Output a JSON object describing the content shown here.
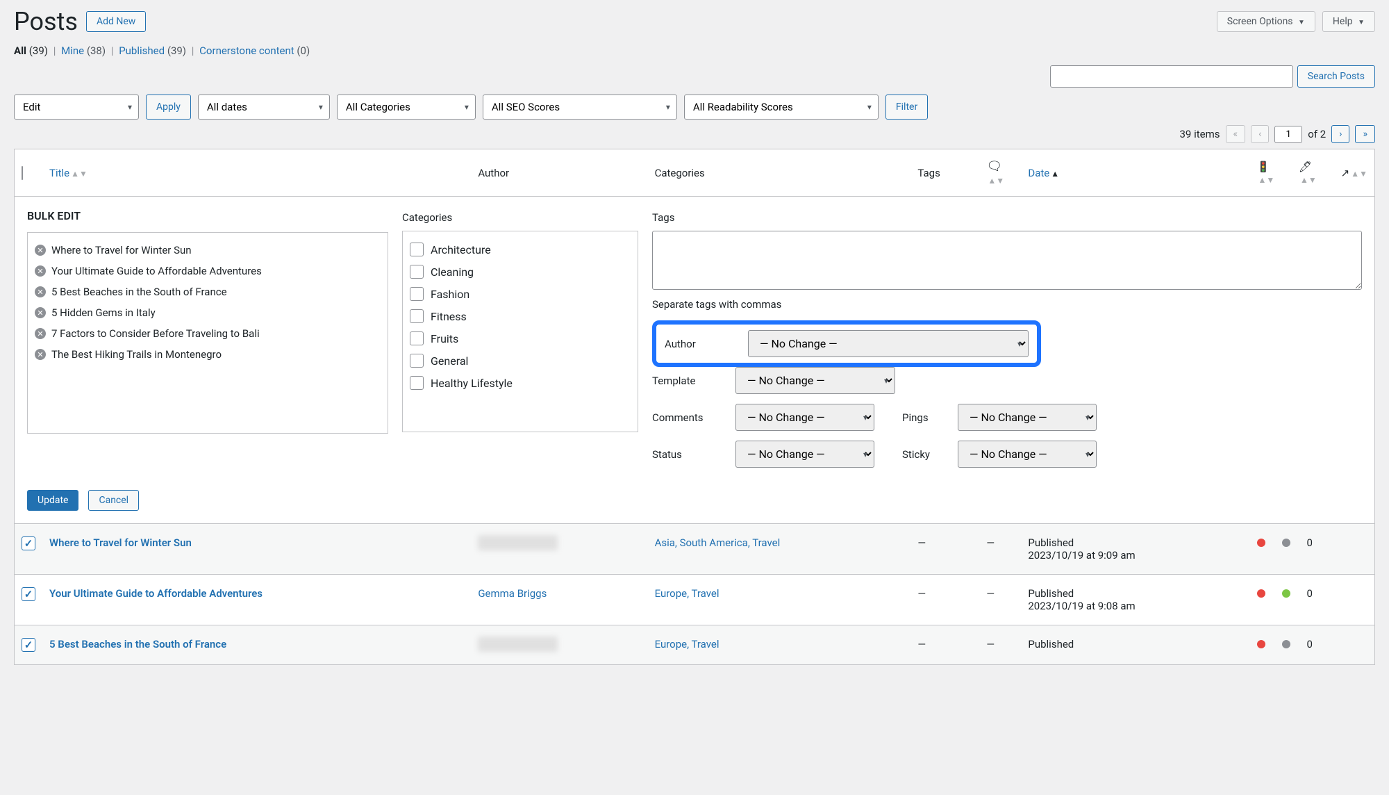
{
  "header": {
    "title": "Posts",
    "add_new": "Add New",
    "screen_options": "Screen Options",
    "help": "Help"
  },
  "filters": {
    "all_label": "All",
    "all_count": "(39)",
    "mine_label": "Mine",
    "mine_count": "(38)",
    "published_label": "Published",
    "published_count": "(39)",
    "cornerstone_label": "Cornerstone content",
    "cornerstone_count": "(0)"
  },
  "search": {
    "button": "Search Posts"
  },
  "bulk": {
    "action": "Edit",
    "apply": "Apply",
    "dates": "All dates",
    "categories": "All Categories",
    "seo": "All SEO Scores",
    "readability": "All Readability Scores",
    "filter": "Filter"
  },
  "pagination": {
    "items": "39 items",
    "current": "1",
    "total": "of 2"
  },
  "columns": {
    "title": "Title",
    "author": "Author",
    "categories": "Categories",
    "tags": "Tags",
    "date": "Date"
  },
  "bulkedit": {
    "heading": "BULK EDIT",
    "cat_heading": "Categories",
    "tags_heading": "Tags",
    "tags_hint": "Separate tags with commas",
    "posts": [
      "Where to Travel for Winter Sun",
      "Your Ultimate Guide to Affordable Adventures",
      "5 Best Beaches in the South of France",
      "5 Hidden Gems in Italy",
      "7 Factors to Consider Before Traveling to Bali",
      "The Best Hiking Trails in Montenegro"
    ],
    "cats": [
      "Architecture",
      "Cleaning",
      "Fashion",
      "Fitness",
      "Fruits",
      "General",
      "Healthy Lifestyle"
    ],
    "labels": {
      "author": "Author",
      "template": "Template",
      "comments": "Comments",
      "status": "Status",
      "pings": "Pings",
      "sticky": "Sticky"
    },
    "nochange": "— No Change —",
    "update": "Update",
    "cancel": "Cancel"
  },
  "rows": [
    {
      "title": "Where to Travel for Winter Sun",
      "author": "hollysantamaria",
      "author_blur": true,
      "cats": "Asia, South America, Travel",
      "tags": "—",
      "comments": "—",
      "status": "Published",
      "date": "2023/10/19 at 9:09 am",
      "seo": "red",
      "read": "grey",
      "links": "0"
    },
    {
      "title": "Your Ultimate Guide to Affordable Adventures",
      "author": "Gemma Briggs",
      "author_blur": false,
      "cats": "Europe, Travel",
      "tags": "—",
      "comments": "—",
      "status": "Published",
      "date": "2023/10/19 at 9:08 am",
      "seo": "red",
      "read": "green",
      "links": "0"
    },
    {
      "title": "5 Best Beaches in the South of France",
      "author": "hollysantamaria",
      "author_blur": true,
      "cats": "Europe, Travel",
      "tags": "—",
      "comments": "—",
      "status": "Published",
      "date": "",
      "seo": "red",
      "read": "grey",
      "links": "0"
    }
  ]
}
